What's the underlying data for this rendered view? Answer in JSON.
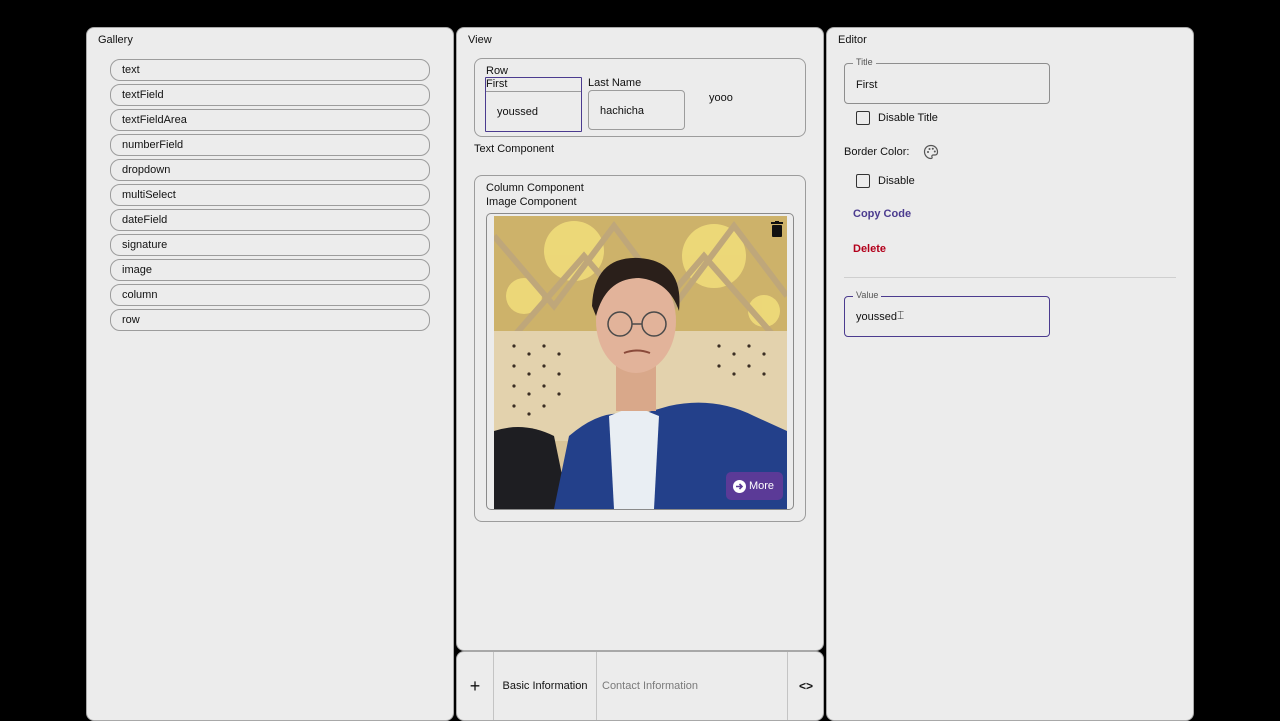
{
  "gallery": {
    "title": "Gallery",
    "items": [
      {
        "label": "text"
      },
      {
        "label": "textField"
      },
      {
        "label": "textFieldArea"
      },
      {
        "label": "numberField"
      },
      {
        "label": "dropdown"
      },
      {
        "label": "multiSelect"
      },
      {
        "label": "dateField"
      },
      {
        "label": "signature"
      },
      {
        "label": "image"
      },
      {
        "label": "column"
      },
      {
        "label": "row"
      }
    ]
  },
  "view": {
    "title": "View",
    "row": {
      "label": "Row",
      "first": {
        "title": "First",
        "value": "youssed"
      },
      "last": {
        "title": "Last Name",
        "value": "hachicha"
      },
      "extra_text": "yooo"
    },
    "text_component": "Text Component",
    "column": {
      "label": "Column Component",
      "image_label": "Image Component",
      "image_icon": "trash-icon",
      "more_label": "More",
      "more_icon": "arrow-right-circle-icon"
    }
  },
  "tabbar": {
    "add_icon": "+",
    "tabs": [
      {
        "label": "Basic Information",
        "active": true
      },
      {
        "label": "Contact Information",
        "active": false
      }
    ],
    "code_icon": "<>"
  },
  "editor": {
    "title": "Editor",
    "title_field": {
      "legend": "Title",
      "value": "First"
    },
    "disable_title": {
      "label": "Disable Title",
      "checked": false
    },
    "border_color_label": "Border Color:",
    "border_color_icon": "palette-icon",
    "disable": {
      "label": "Disable",
      "checked": false
    },
    "copy_code_label": "Copy Code",
    "delete_label": "Delete",
    "value_field": {
      "legend": "Value",
      "value": "youssed"
    }
  },
  "colors": {
    "accent": "#4b3b8f",
    "more_button": "#5b3a97",
    "delete": "#b3001b",
    "panel_bg": "#ececec"
  }
}
